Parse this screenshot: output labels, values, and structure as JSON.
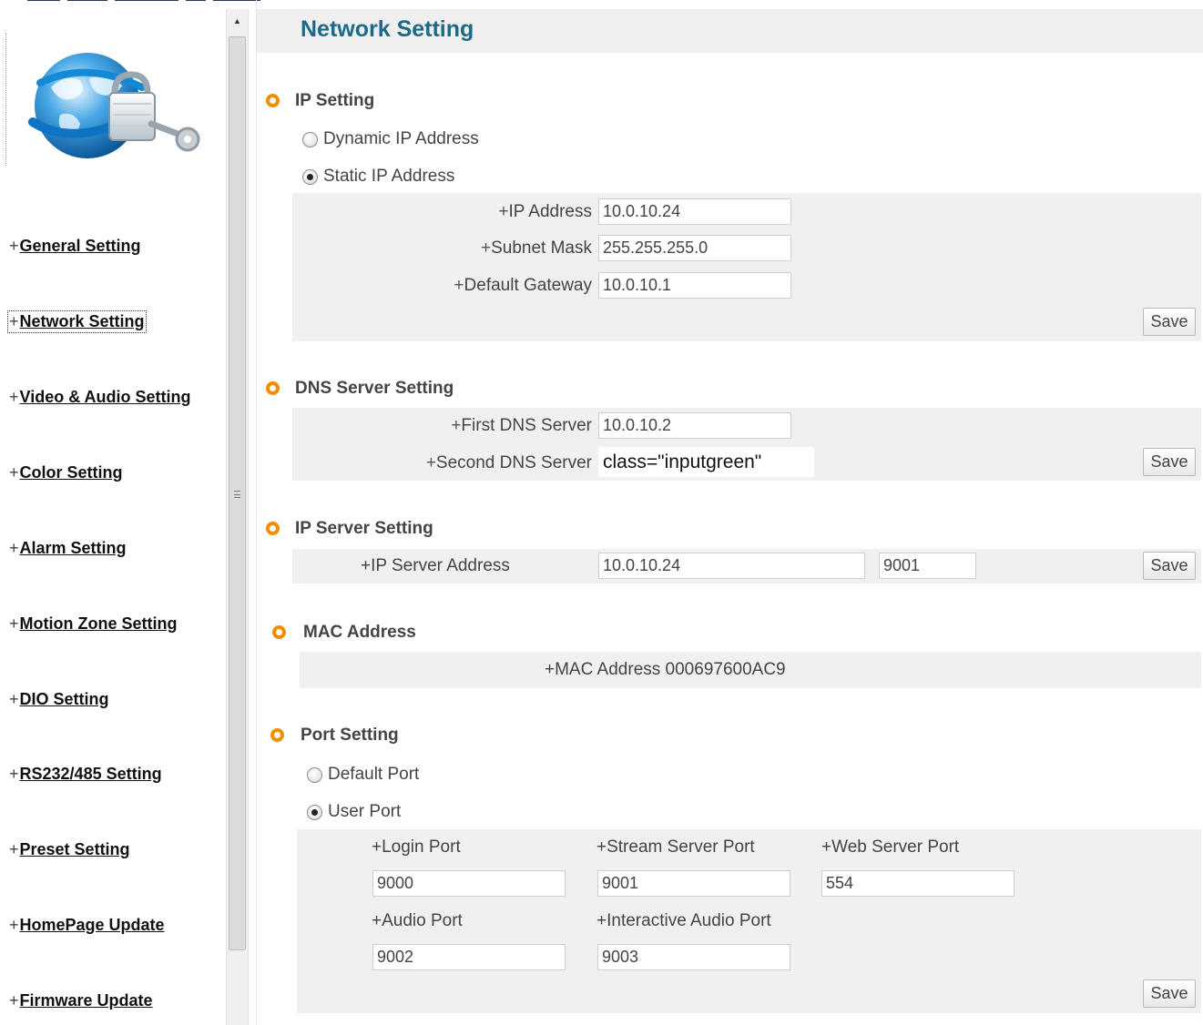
{
  "header": {
    "title": "Network Setting"
  },
  "sidebar": {
    "items": [
      {
        "label": "General Setting",
        "active": false
      },
      {
        "label": "Network Setting",
        "active": true
      },
      {
        "label": "Video & Audio Setting",
        "active": false
      },
      {
        "label": "Color Setting",
        "active": false
      },
      {
        "label": "Alarm Setting",
        "active": false
      },
      {
        "label": "Motion Zone Setting",
        "active": false
      },
      {
        "label": "DIO Setting",
        "active": false
      },
      {
        "label": "RS232/485 Setting",
        "active": false
      },
      {
        "label": "Preset Setting",
        "active": false
      },
      {
        "label": "HomePage Update",
        "active": false
      },
      {
        "label": "Firmware Update",
        "active": false
      }
    ]
  },
  "ip_setting": {
    "title": "IP Setting",
    "dynamic_label": "Dynamic IP Address",
    "static_label": "Static IP Address",
    "selected": "static",
    "ip_address_label": "IP Address",
    "ip_address": "10.0.10.24",
    "subnet_mask_label": "Subnet Mask",
    "subnet_mask": "255.255.255.0",
    "gateway_label": "Default Gateway",
    "gateway": "10.0.10.1",
    "save_label": "Save"
  },
  "dns": {
    "title": "DNS Server Setting",
    "first_label": "First DNS Server",
    "first": "10.0.10.2",
    "second_label": "Second DNS Server",
    "second": "class=\"inputgreen\"",
    "save_label": "Save"
  },
  "ip_server": {
    "title": "IP Server Setting",
    "address_label": "IP Server Address",
    "address": "10.0.10.24",
    "port": "9001",
    "save_label": "Save"
  },
  "mac": {
    "title": "MAC Address",
    "label": "MAC Address",
    "value": "000697600AC9"
  },
  "port_setting": {
    "title": "Port Setting",
    "default_label": "Default Port",
    "user_label": "User Port",
    "selected": "user",
    "login_label": "Login Port",
    "login": "9000",
    "stream_label": "Stream Server Port",
    "stream": "9001",
    "web_label": "Web Server Port",
    "web": "554",
    "audio_label": "Audio Port",
    "audio": "9002",
    "interactive_label": "Interactive Audio Port",
    "interactive": "9003",
    "save_label": "Save"
  },
  "colors": {
    "accent": "#f28c00",
    "title": "#1b6a8a",
    "panel": "#f0f0f0"
  },
  "icons": {
    "logo": "globe-lock-key-logo",
    "bullet": "orange-ring-bullet"
  }
}
